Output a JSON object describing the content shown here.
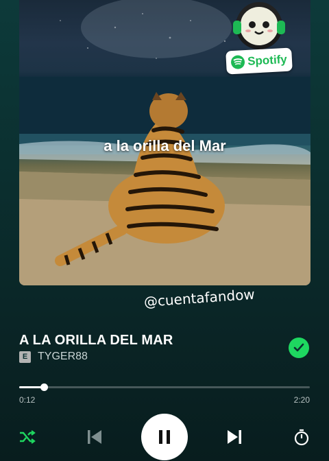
{
  "artwork": {
    "caption": "a la orilla del Mar"
  },
  "sticker": {
    "brand_text": "Spotify",
    "icon": "spotify-logo-icon",
    "mascot_icon": "smiling-headphones-mascot-icon"
  },
  "watermark": "@cuentafandow",
  "track": {
    "title": "A LA ORILLA DEL MAR",
    "explicit_badge": "E",
    "artist": "TYGER88",
    "liked": true
  },
  "progress": {
    "elapsed": "0:12",
    "total": "2:20",
    "fraction": 0.0857
  },
  "controls": {
    "shuffle_icon": "shuffle-icon",
    "prev_icon": "skip-previous-icon",
    "play_state_icon": "pause-icon",
    "next_icon": "skip-next-icon",
    "timer_icon": "sleep-timer-icon"
  },
  "colors": {
    "accent": "#1ed760",
    "background_top": "#0d3a3a",
    "background_bottom": "#081d1e"
  }
}
